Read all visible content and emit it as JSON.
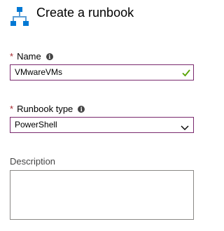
{
  "header": {
    "title": "Create a runbook",
    "icon": "runbook-icon"
  },
  "form": {
    "name": {
      "label": "Name",
      "required_marker": "*",
      "value": "VMwareVMs",
      "valid": true
    },
    "runbook_type": {
      "label": "Runbook type",
      "required_marker": "*",
      "selected": "PowerShell"
    },
    "description": {
      "label": "Description",
      "value": ""
    }
  },
  "colors": {
    "accent": "#0078d4",
    "focus_border": "#7a2a6e",
    "required": "#a4262c",
    "valid_check": "#57a300"
  }
}
